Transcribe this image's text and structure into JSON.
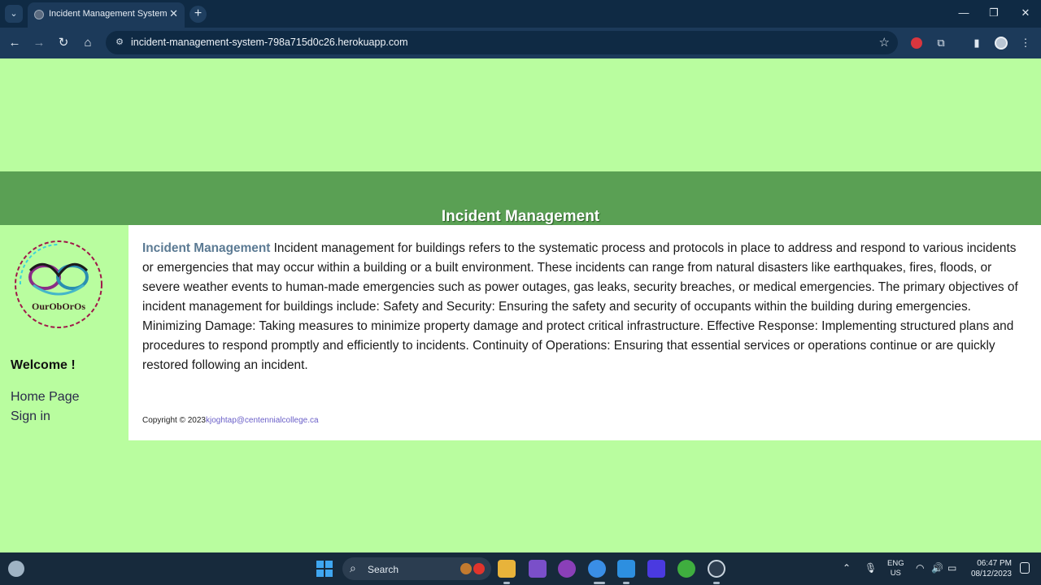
{
  "browser": {
    "tab_title": "Incident Management System",
    "url": "incident-management-system-798a715d0c26.herokuapp.com"
  },
  "page": {
    "header_title": "Incident Management",
    "sidebar": {
      "logo_text": "OurObOrOs",
      "welcome": "Welcome !",
      "links": [
        "Home Page",
        "Sign in"
      ]
    },
    "article": {
      "title": "Incident Management",
      "body": "Incident management for buildings refers to the systematic process and protocols in place to address and respond to various incidents or emergencies that may occur within a building or a built environment. These incidents can range from natural disasters like earthquakes, fires, floods, or severe weather events to human-made emergencies such as power outages, gas leaks, security breaches, or medical emergencies. The primary objectives of incident management for buildings include: Safety and Security: Ensuring the safety and security of occupants within the building during emergencies. Minimizing Damage: Taking measures to minimize property damage and protect critical infrastructure. Effective Response: Implementing structured plans and procedures to respond promptly and efficiently to incidents. Continuity of Operations: Ensuring that essential services or operations continue or are quickly restored following an incident."
    },
    "footer": {
      "copyright": "Copyright © 2023",
      "email": "kjoghtap@centennialcollege.ca"
    }
  },
  "taskbar": {
    "search_placeholder": "Search",
    "lang_line1": "ENG",
    "lang_line2": "US",
    "time": "06:47 PM",
    "date": "08/12/2023"
  },
  "colors": {
    "page_bg": "#b9fd9f",
    "header_band": "#5aa054",
    "article_title": "#5b7a93",
    "link": "#6a5fc8"
  }
}
